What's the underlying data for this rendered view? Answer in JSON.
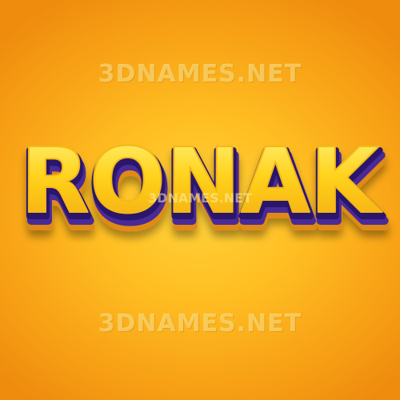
{
  "artwork": {
    "name_text": "RONAK",
    "watermark_top": "3DNAMES.NET",
    "watermark_middle": "3DNAMES.NET",
    "watermark_bottom": "3DNAMES.NET"
  },
  "colors": {
    "background_center": "#ffd23a",
    "background_edge": "#ef8c0e",
    "letter_fill": "#ffd21c",
    "letter_shade": "#f2a70c",
    "letter_depth": "#4a2a96",
    "letter_outline": "#2b166b"
  }
}
